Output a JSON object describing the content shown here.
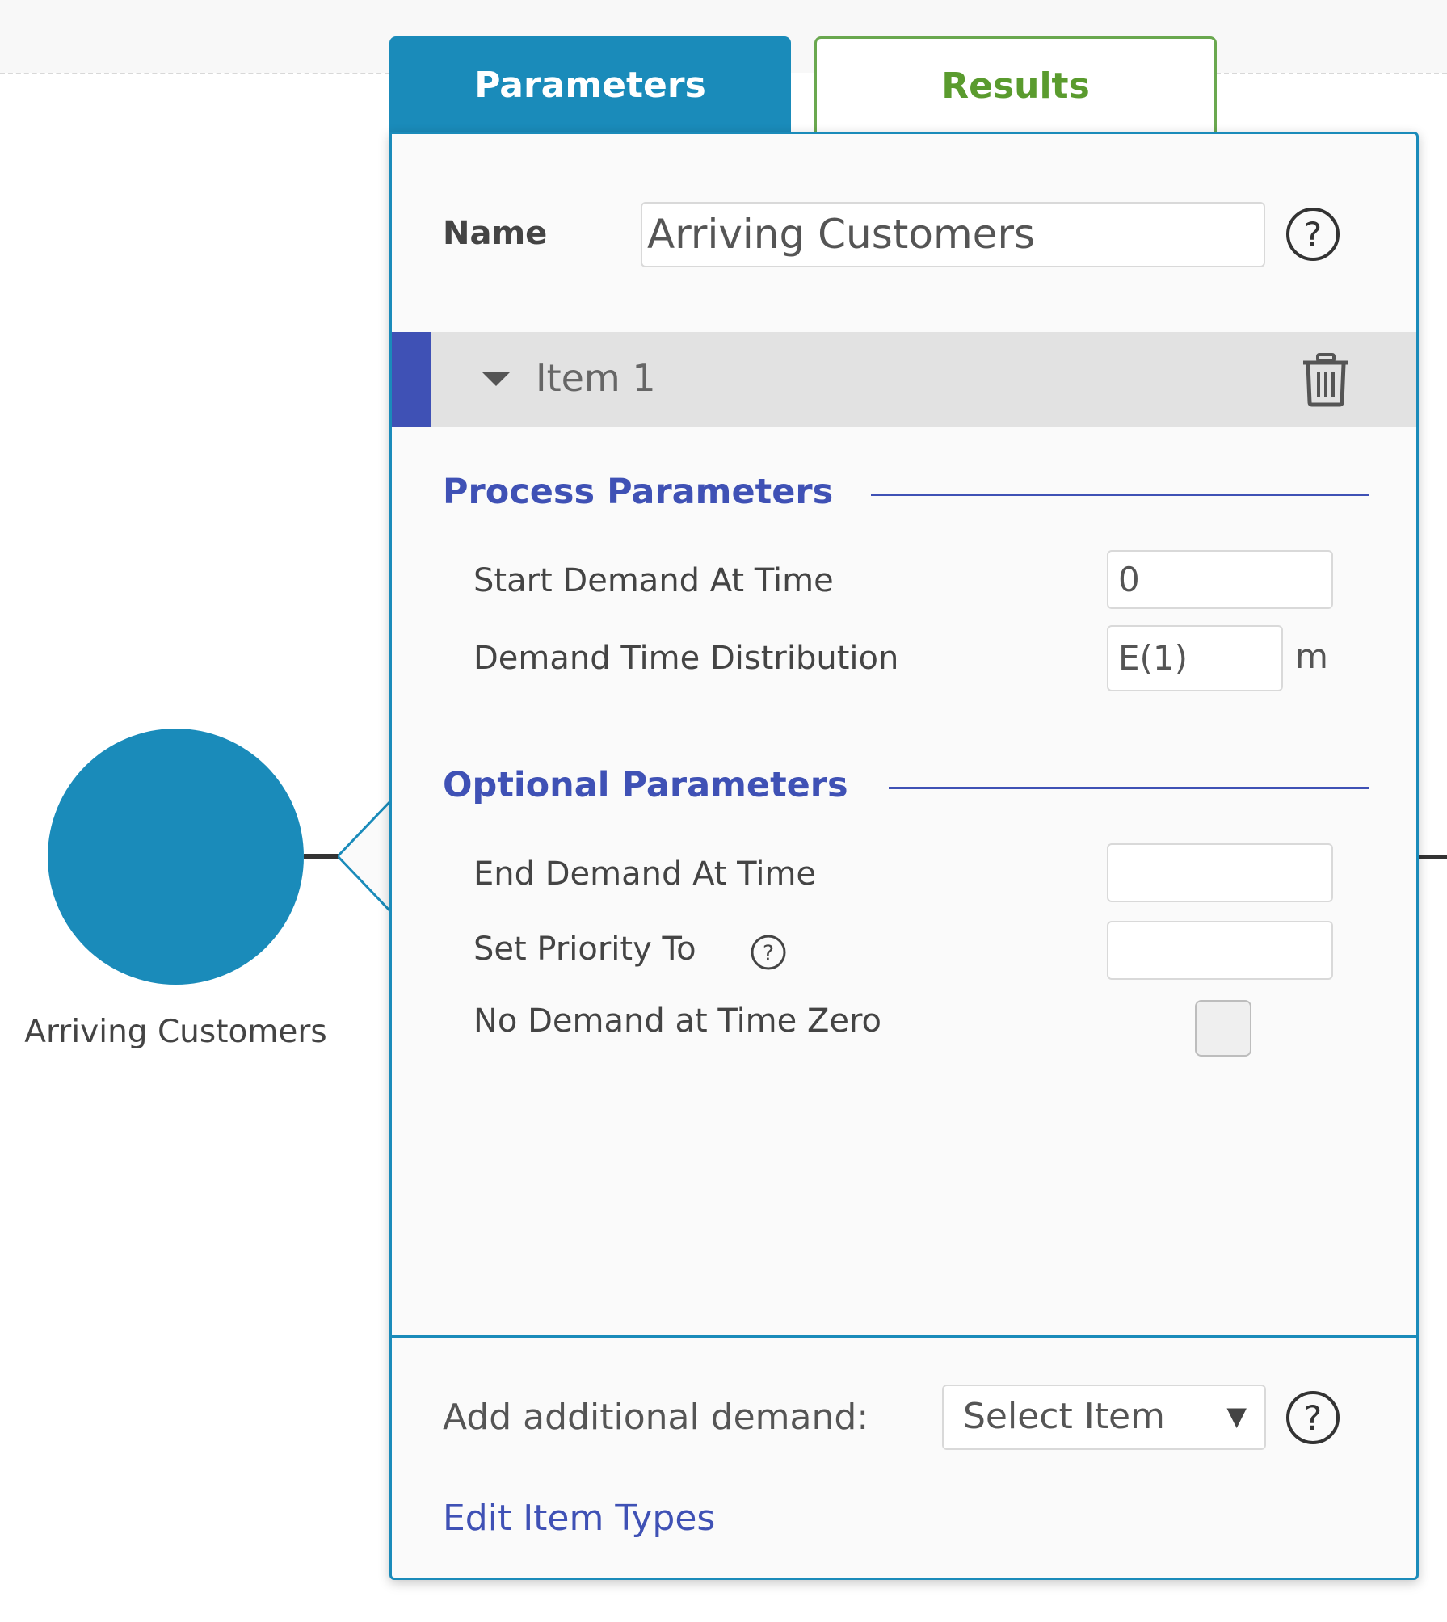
{
  "tabs": {
    "parameters": "Parameters",
    "results": "Results"
  },
  "node": {
    "label": "Arriving Customers",
    "color": "#1a8bba"
  },
  "panel": {
    "name_label": "Name",
    "name_value": "Arriving Customers",
    "item": {
      "title": "Item 1",
      "accent_color": "#3f51b5"
    },
    "process_section": {
      "title": "Process Parameters",
      "start_label": "Start Demand At Time",
      "start_value": "0",
      "dist_label": "Demand Time Distribution",
      "dist_value": "E(1)",
      "dist_unit": "m"
    },
    "optional_section": {
      "title": "Optional Parameters",
      "end_label": "End Demand At Time",
      "end_value": "",
      "priority_label": "Set Priority To",
      "priority_value": "",
      "no_demand_label": "No Demand at Time Zero",
      "no_demand_checked": false
    },
    "footer": {
      "add_label": "Add additional demand:",
      "select_value": "Select Item",
      "edit_link": "Edit Item Types"
    }
  },
  "icons": {
    "help": "help-icon",
    "trash": "trash-icon",
    "caret": "caret-down-icon",
    "dropdown": "dropdown-arrow-icon"
  },
  "colors": {
    "tab_active": "#1a8bba",
    "tab_results": "#5a9b2e",
    "section_title": "#3f51b5",
    "panel_border": "#1a8bba"
  }
}
